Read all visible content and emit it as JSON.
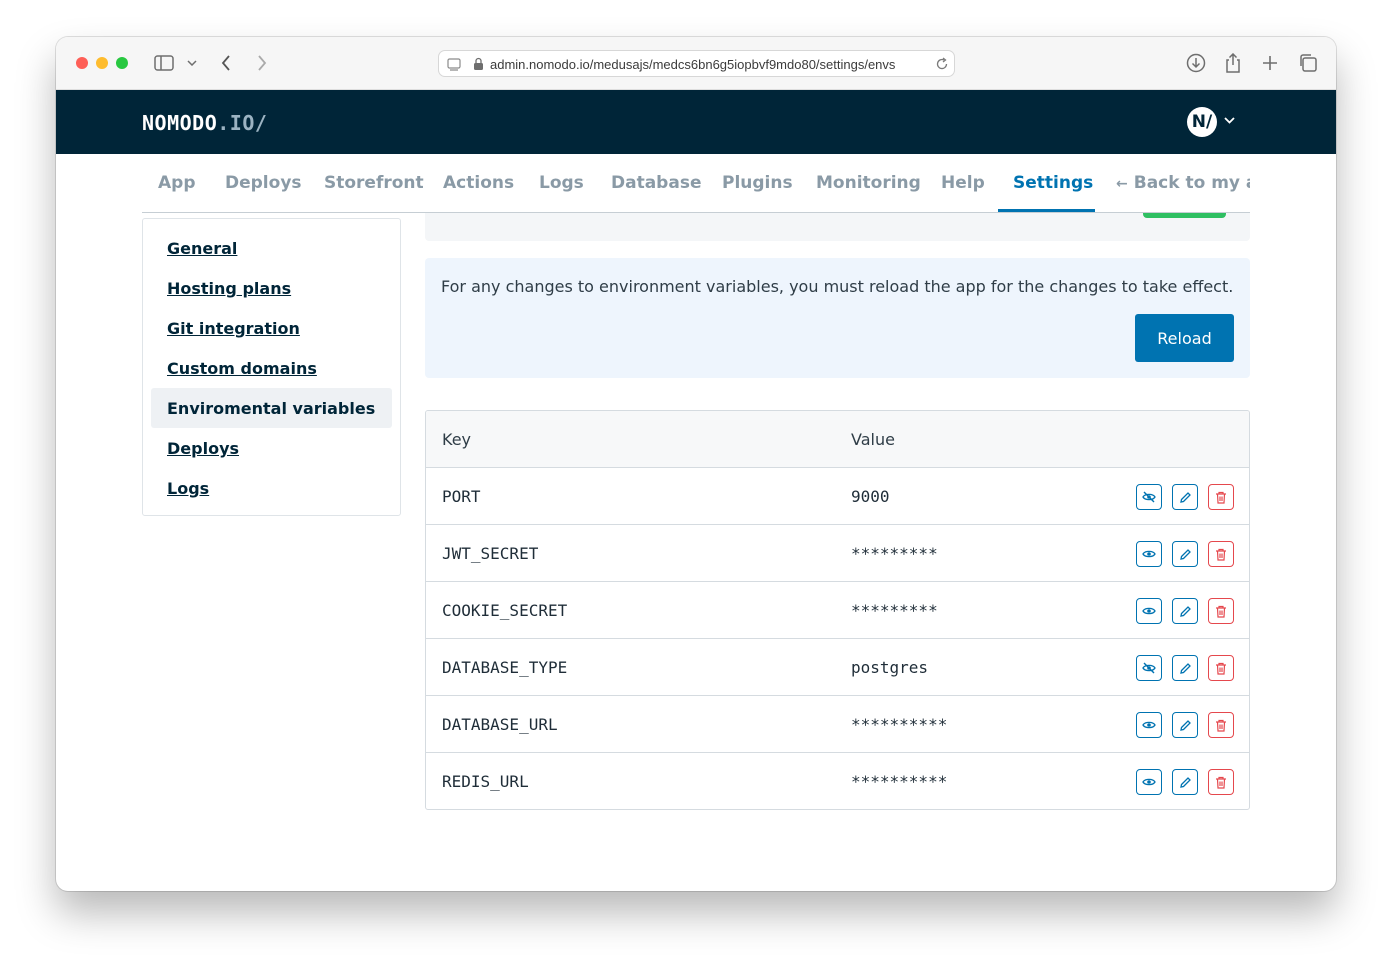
{
  "browser": {
    "url": "admin.nomodo.io/medusajs/medcs6bn6g5iopbvf9mdo80/settings/envs"
  },
  "header": {
    "logo_main": "NOMODO",
    "logo_accent": ".IO/",
    "avatar_initials": "N/"
  },
  "tabs": [
    {
      "label": "App"
    },
    {
      "label": "Deploys"
    },
    {
      "label": "Storefront"
    },
    {
      "label": "Actions"
    },
    {
      "label": "Logs"
    },
    {
      "label": "Database"
    },
    {
      "label": "Plugins"
    },
    {
      "label": "Monitoring"
    },
    {
      "label": "Help"
    },
    {
      "label": "Settings"
    },
    {
      "label": "Back to my ap"
    }
  ],
  "sidebar": {
    "items": [
      {
        "label": "General"
      },
      {
        "label": "Hosting plans"
      },
      {
        "label": "Git integration"
      },
      {
        "label": "Custom domains"
      },
      {
        "label": "Enviromental variables"
      },
      {
        "label": "Deploys"
      },
      {
        "label": "Logs"
      }
    ]
  },
  "notice": {
    "text": "For any changes to environment variables, you must reload the app for the changes to take effect.",
    "reload_label": "Reload"
  },
  "table": {
    "headers": {
      "key": "Key",
      "value": "Value"
    },
    "rows": [
      {
        "key": "PORT",
        "value": "9000",
        "visibility_icon": "eye-off-icon"
      },
      {
        "key": "JWT_SECRET",
        "value": "*********",
        "visibility_icon": "eye-icon"
      },
      {
        "key": "COOKIE_SECRET",
        "value": "*********",
        "visibility_icon": "eye-icon"
      },
      {
        "key": "DATABASE_TYPE",
        "value": "postgres",
        "visibility_icon": "eye-off-icon"
      },
      {
        "key": "DATABASE_URL",
        "value": "**********",
        "visibility_icon": "eye-icon"
      },
      {
        "key": "REDIS_URL",
        "value": "**********",
        "visibility_icon": "eye-icon"
      }
    ]
  },
  "colors": {
    "header_bg": "#002538",
    "accent": "#0073b1",
    "danger": "#e5484d",
    "notice_bg": "#eef5fd"
  }
}
